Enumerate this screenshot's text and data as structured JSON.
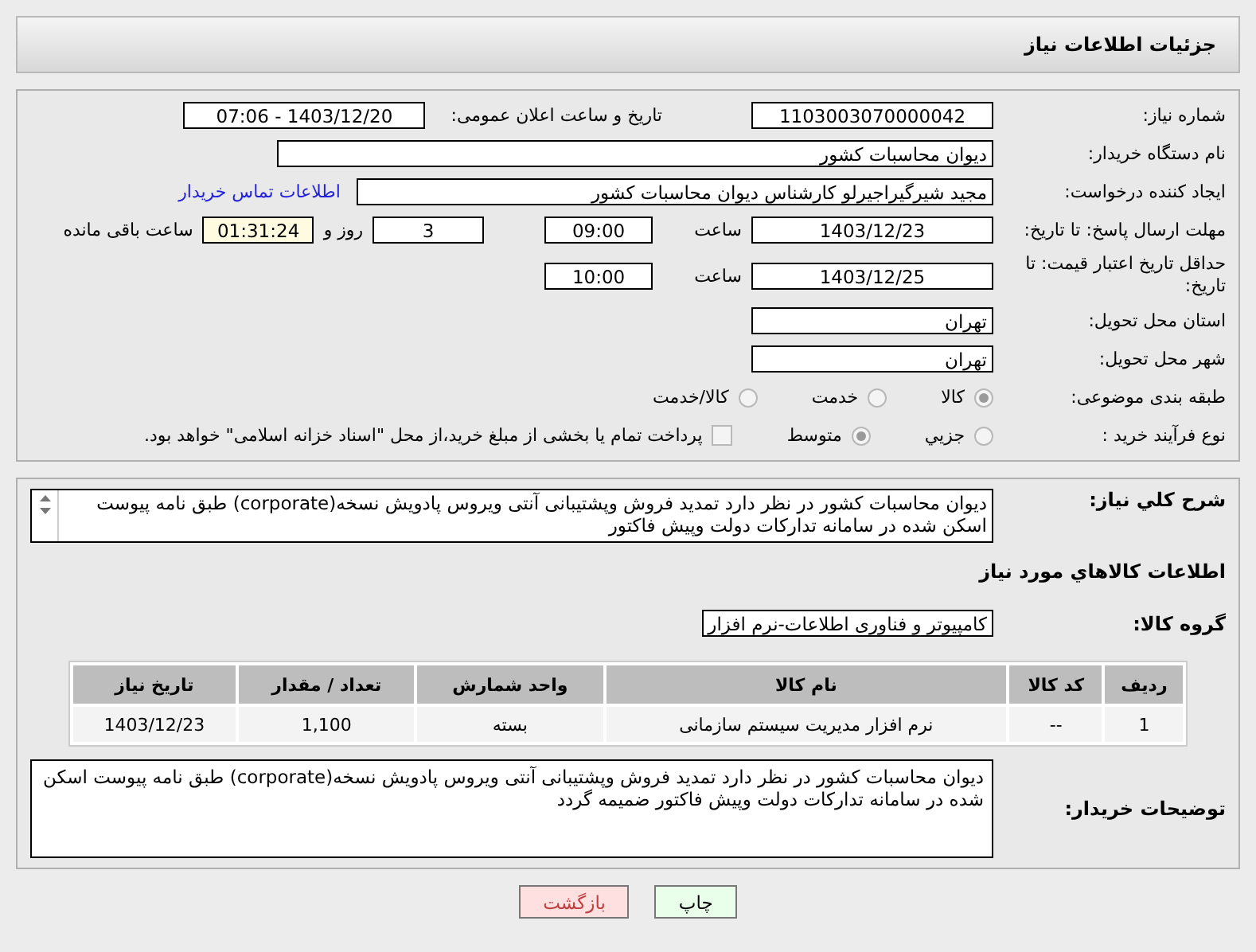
{
  "header": {
    "title": "جزئیات اطلاعات نیاز"
  },
  "need_number": {
    "label": "شماره نیاز:",
    "value": "1103003070000042"
  },
  "announce_datetime": {
    "label": "تاریخ و ساعت اعلان عمومی:",
    "value": "1403/12/20 - 07:06"
  },
  "buyer_org": {
    "label": "نام دستگاه خریدار:",
    "value": "دیوان محاسبات کشور"
  },
  "requester": {
    "label": "ایجاد کننده درخواست:",
    "value": "مجید شیرگیراجیرلو کارشناس دیوان محاسبات کشور",
    "contact_link": "اطلاعات تماس خریدار"
  },
  "reply_deadline": {
    "label": "مهلت ارسال پاسخ: تا تاریخ:",
    "date": "1403/12/23",
    "time_label": "ساعت",
    "time": "09:00",
    "days": "3",
    "days_label": "روز و",
    "remaining": "01:31:24",
    "remaining_label": "ساعت باقی مانده"
  },
  "price_validity": {
    "label": "حداقل تاریخ اعتبار قیمت: تا تاریخ:",
    "date": "1403/12/25",
    "time_label": "ساعت",
    "time": "10:00"
  },
  "province": {
    "label": "استان محل تحویل:",
    "value": "تهران"
  },
  "city": {
    "label": "شهر محل تحویل:",
    "value": "تهران"
  },
  "category": {
    "label": "طبقه بندی موضوعی:",
    "options": [
      {
        "label": "کالا",
        "selected": true
      },
      {
        "label": "خدمت",
        "selected": false
      },
      {
        "label": "کالا/خدمت",
        "selected": false
      }
    ]
  },
  "process": {
    "label": "نوع فرآیند خرید :",
    "options": [
      {
        "label": "جزیي",
        "selected": false
      },
      {
        "label": "متوسط",
        "selected": true
      }
    ],
    "payment_note": {
      "label": "پرداخت تمام یا بخشی از مبلغ خرید،از محل \"اسناد خزانه اسلامی\" خواهد بود.",
      "checked": false
    }
  },
  "description": {
    "label": "شرح کلي نیاز:",
    "text": "دیوان محاسبات کشور در نظر دارد تمدید فروش وپشتیبانی آنتی ویروس پادویش نسخه(corporate) طبق نامه پیوست اسکن شده در سامانه تدارکات دولت  وپیش فاکتور"
  },
  "goods_heading": "اطلاعات کالاهاي مورد نیاز",
  "goods_group": {
    "label": "گروه کالا:",
    "value": "کامپیوتر و فناوری اطلاعات-نرم افزار"
  },
  "table": {
    "columns": [
      "ردیف",
      "کد کالا",
      "نام کالا",
      "واحد شمارش",
      "تعداد / مقدار",
      "تاریخ نیاز"
    ],
    "rows": [
      [
        "1",
        "--",
        "نرم افزار مدیریت سیستم سازمانی",
        "بسته",
        "1,100",
        "1403/12/23"
      ]
    ]
  },
  "buyer_notes": {
    "label": "توضیحات خریدار:",
    "text": "دیوان محاسبات کشور در نظر دارد تمدید فروش وپشتیبانی آنتی ویروس پادویش نسخه(corporate) طبق نامه پیوست اسکن شده در سامانه تدارکات دولت  وپیش فاکتور ضمیمه گردد"
  },
  "buttons": [
    {
      "label": "چاپ",
      "kind": "print"
    },
    {
      "label": "بازگشت",
      "kind": "back"
    }
  ]
}
